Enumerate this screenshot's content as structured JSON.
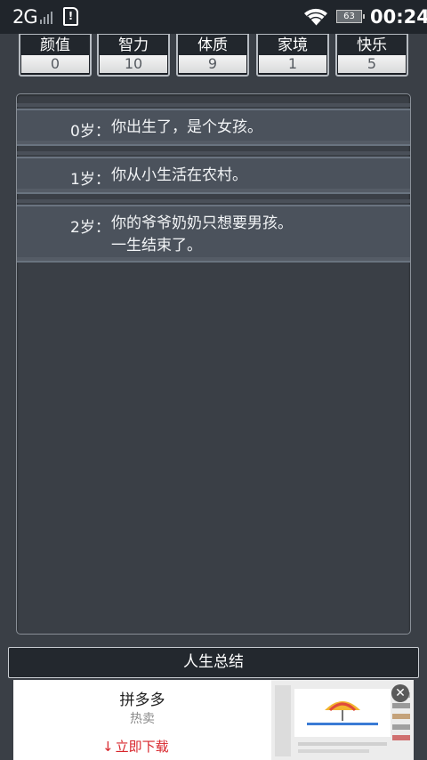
{
  "status_bar": {
    "network": "2G",
    "battery": "63",
    "time": "00:24",
    "signal_icon": "signal-bars-icon",
    "sim_icon": "sim-alert-icon",
    "wifi_icon": "wifi-icon",
    "battery_icon": "battery-icon"
  },
  "stats": [
    {
      "label": "颜值",
      "value": "0"
    },
    {
      "label": "智力",
      "value": "10"
    },
    {
      "label": "体质",
      "value": "9"
    },
    {
      "label": "家境",
      "value": "1"
    },
    {
      "label": "快乐",
      "value": "5"
    }
  ],
  "log": [
    {
      "age": "0岁：",
      "lines": [
        "你出生了，是个女孩。"
      ]
    },
    {
      "age": "1岁：",
      "lines": [
        "你从小生活在农村。"
      ]
    },
    {
      "age": "2岁：",
      "lines": [
        "你的爷爷奶奶只想要男孩。",
        "一生结束了。"
      ]
    }
  ],
  "summary_button": "人生总结",
  "ad": {
    "title": "拼多多",
    "subtitle": "热卖",
    "cta": "立即下载",
    "cta_icon": "download-arrow-icon",
    "close_icon": "close-icon",
    "accent": "#d8262c"
  },
  "colors": {
    "background": "#3a3f46",
    "status_bar": "#20252b",
    "entry": "#4b525c"
  }
}
